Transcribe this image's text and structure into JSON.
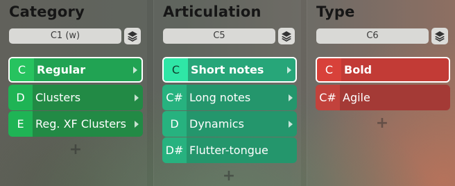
{
  "columns": [
    {
      "title": "Category",
      "key": "C1 (w)",
      "items": [
        {
          "note": "C",
          "label": "Regular",
          "selected": true,
          "has_children": true
        },
        {
          "note": "D",
          "label": "Clusters",
          "selected": false,
          "has_children": true
        },
        {
          "note": "E",
          "label": "Reg. XF Clusters",
          "selected": false,
          "has_children": true
        }
      ],
      "add_label": "+"
    },
    {
      "title": "Articulation",
      "key": "C5",
      "items": [
        {
          "note": "C",
          "label": "Short notes",
          "selected": true,
          "has_children": true
        },
        {
          "note": "C#",
          "label": "Long notes",
          "selected": false,
          "has_children": true
        },
        {
          "note": "D",
          "label": "Dynamics",
          "selected": false,
          "has_children": true
        },
        {
          "note": "D#",
          "label": "Flutter-tongue",
          "selected": false,
          "has_children": false
        }
      ],
      "add_label": "+"
    },
    {
      "title": "Type",
      "key": "C6",
      "items": [
        {
          "note": "C",
          "label": "Bold",
          "selected": true,
          "has_children": false
        },
        {
          "note": "C#",
          "label": "Agile",
          "selected": false,
          "has_children": false
        }
      ],
      "add_label": "+"
    }
  ],
  "colors": {
    "category": "#228a45",
    "articulation": "#24966c",
    "type": "#a43a36"
  },
  "icons": {
    "stack_button": "layers-icon",
    "expand": "chevron-right-icon",
    "add": "plus-icon"
  }
}
